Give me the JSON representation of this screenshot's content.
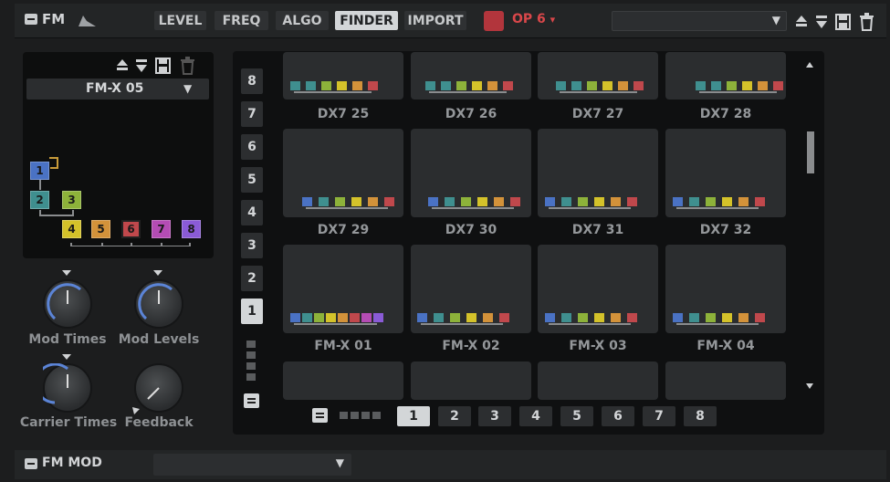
{
  "header": {
    "title": "FM",
    "tabs": [
      {
        "label": "LEVEL"
      },
      {
        "label": "FREQ"
      },
      {
        "label": "ALGO"
      },
      {
        "label": "FINDER"
      },
      {
        "label": "IMPORT"
      }
    ],
    "active_tab": "FINDER",
    "operator_label": "OP 6",
    "operator_color": "#b2353c",
    "preset_dropdown_value": ""
  },
  "left_panel": {
    "preset_name": "FM-X 05",
    "operators": [
      "1",
      "2",
      "3",
      "4",
      "5",
      "6",
      "7",
      "8"
    ],
    "knobs": [
      {
        "label": "Mod Times"
      },
      {
        "label": "Mod Levels"
      },
      {
        "label": "Carrier Times"
      },
      {
        "label": "Feedback"
      }
    ]
  },
  "finder": {
    "row_numbers": [
      "8",
      "7",
      "6",
      "5",
      "4",
      "3",
      "2",
      "1"
    ],
    "selected_row": "1",
    "tiles": [
      {
        "label": "DX7 25"
      },
      {
        "label": "DX7 26"
      },
      {
        "label": "DX7 27"
      },
      {
        "label": "DX7 28"
      },
      {
        "label": "DX7 29"
      },
      {
        "label": "DX7 30"
      },
      {
        "label": "DX7 31"
      },
      {
        "label": "DX7 32"
      },
      {
        "label": "FM-X 01"
      },
      {
        "label": "FM-X 02"
      },
      {
        "label": "FM-X 03"
      },
      {
        "label": "FM-X 04"
      }
    ],
    "pages": [
      "1",
      "2",
      "3",
      "4",
      "5",
      "6",
      "7",
      "8"
    ],
    "selected_page": "1"
  },
  "footer": {
    "title": "FM MOD",
    "dropdown_value": ""
  },
  "colors": {
    "op1": "#4a72c4",
    "op2": "#3f8f8f",
    "op3": "#8db23a",
    "op4": "#d4c22a",
    "op5": "#d3923a",
    "op6": "#c0484c",
    "op7": "#b44cb4",
    "op8": "#8a5bd6"
  }
}
